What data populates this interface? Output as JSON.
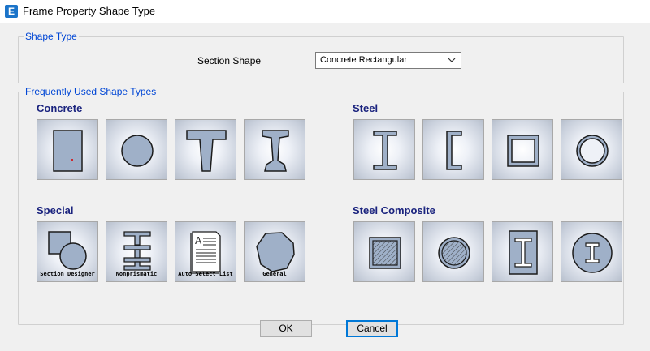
{
  "window": {
    "app_icon": "E",
    "title": "Frame Property Shape Type"
  },
  "shape_type_group": {
    "title": "Shape Type",
    "section_shape_label": "Section Shape",
    "section_shape_value": "Concrete Rectangular"
  },
  "frequent_group": {
    "title": "Frequently Used Shape Types",
    "categories": {
      "concrete": {
        "title": "Concrete",
        "icons": [
          "rectangular-section-icon",
          "circular-section-icon",
          "tee-section-icon",
          "i-section-icon"
        ]
      },
      "steel": {
        "title": "Steel",
        "icons": [
          "steel-i-section-icon",
          "steel-channel-icon",
          "steel-box-tube-icon",
          "steel-pipe-icon"
        ]
      },
      "special": {
        "title": "Special",
        "captions": [
          "Section Designer",
          "Nonprismatic",
          "Auto Select List",
          "General"
        ]
      },
      "steel_composite": {
        "title": "Steel Composite",
        "icons": [
          "filled-tube-icon",
          "filled-pipe-icon",
          "encased-rect-icon",
          "encased-circle-icon"
        ]
      }
    }
  },
  "buttons": {
    "ok": "OK",
    "cancel": "Cancel"
  },
  "colors": {
    "shape_fill": "#9fb0c8",
    "shape_stroke": "#1c1c1c",
    "title_blue": "#0046d5",
    "category_blue": "#1a237e"
  }
}
